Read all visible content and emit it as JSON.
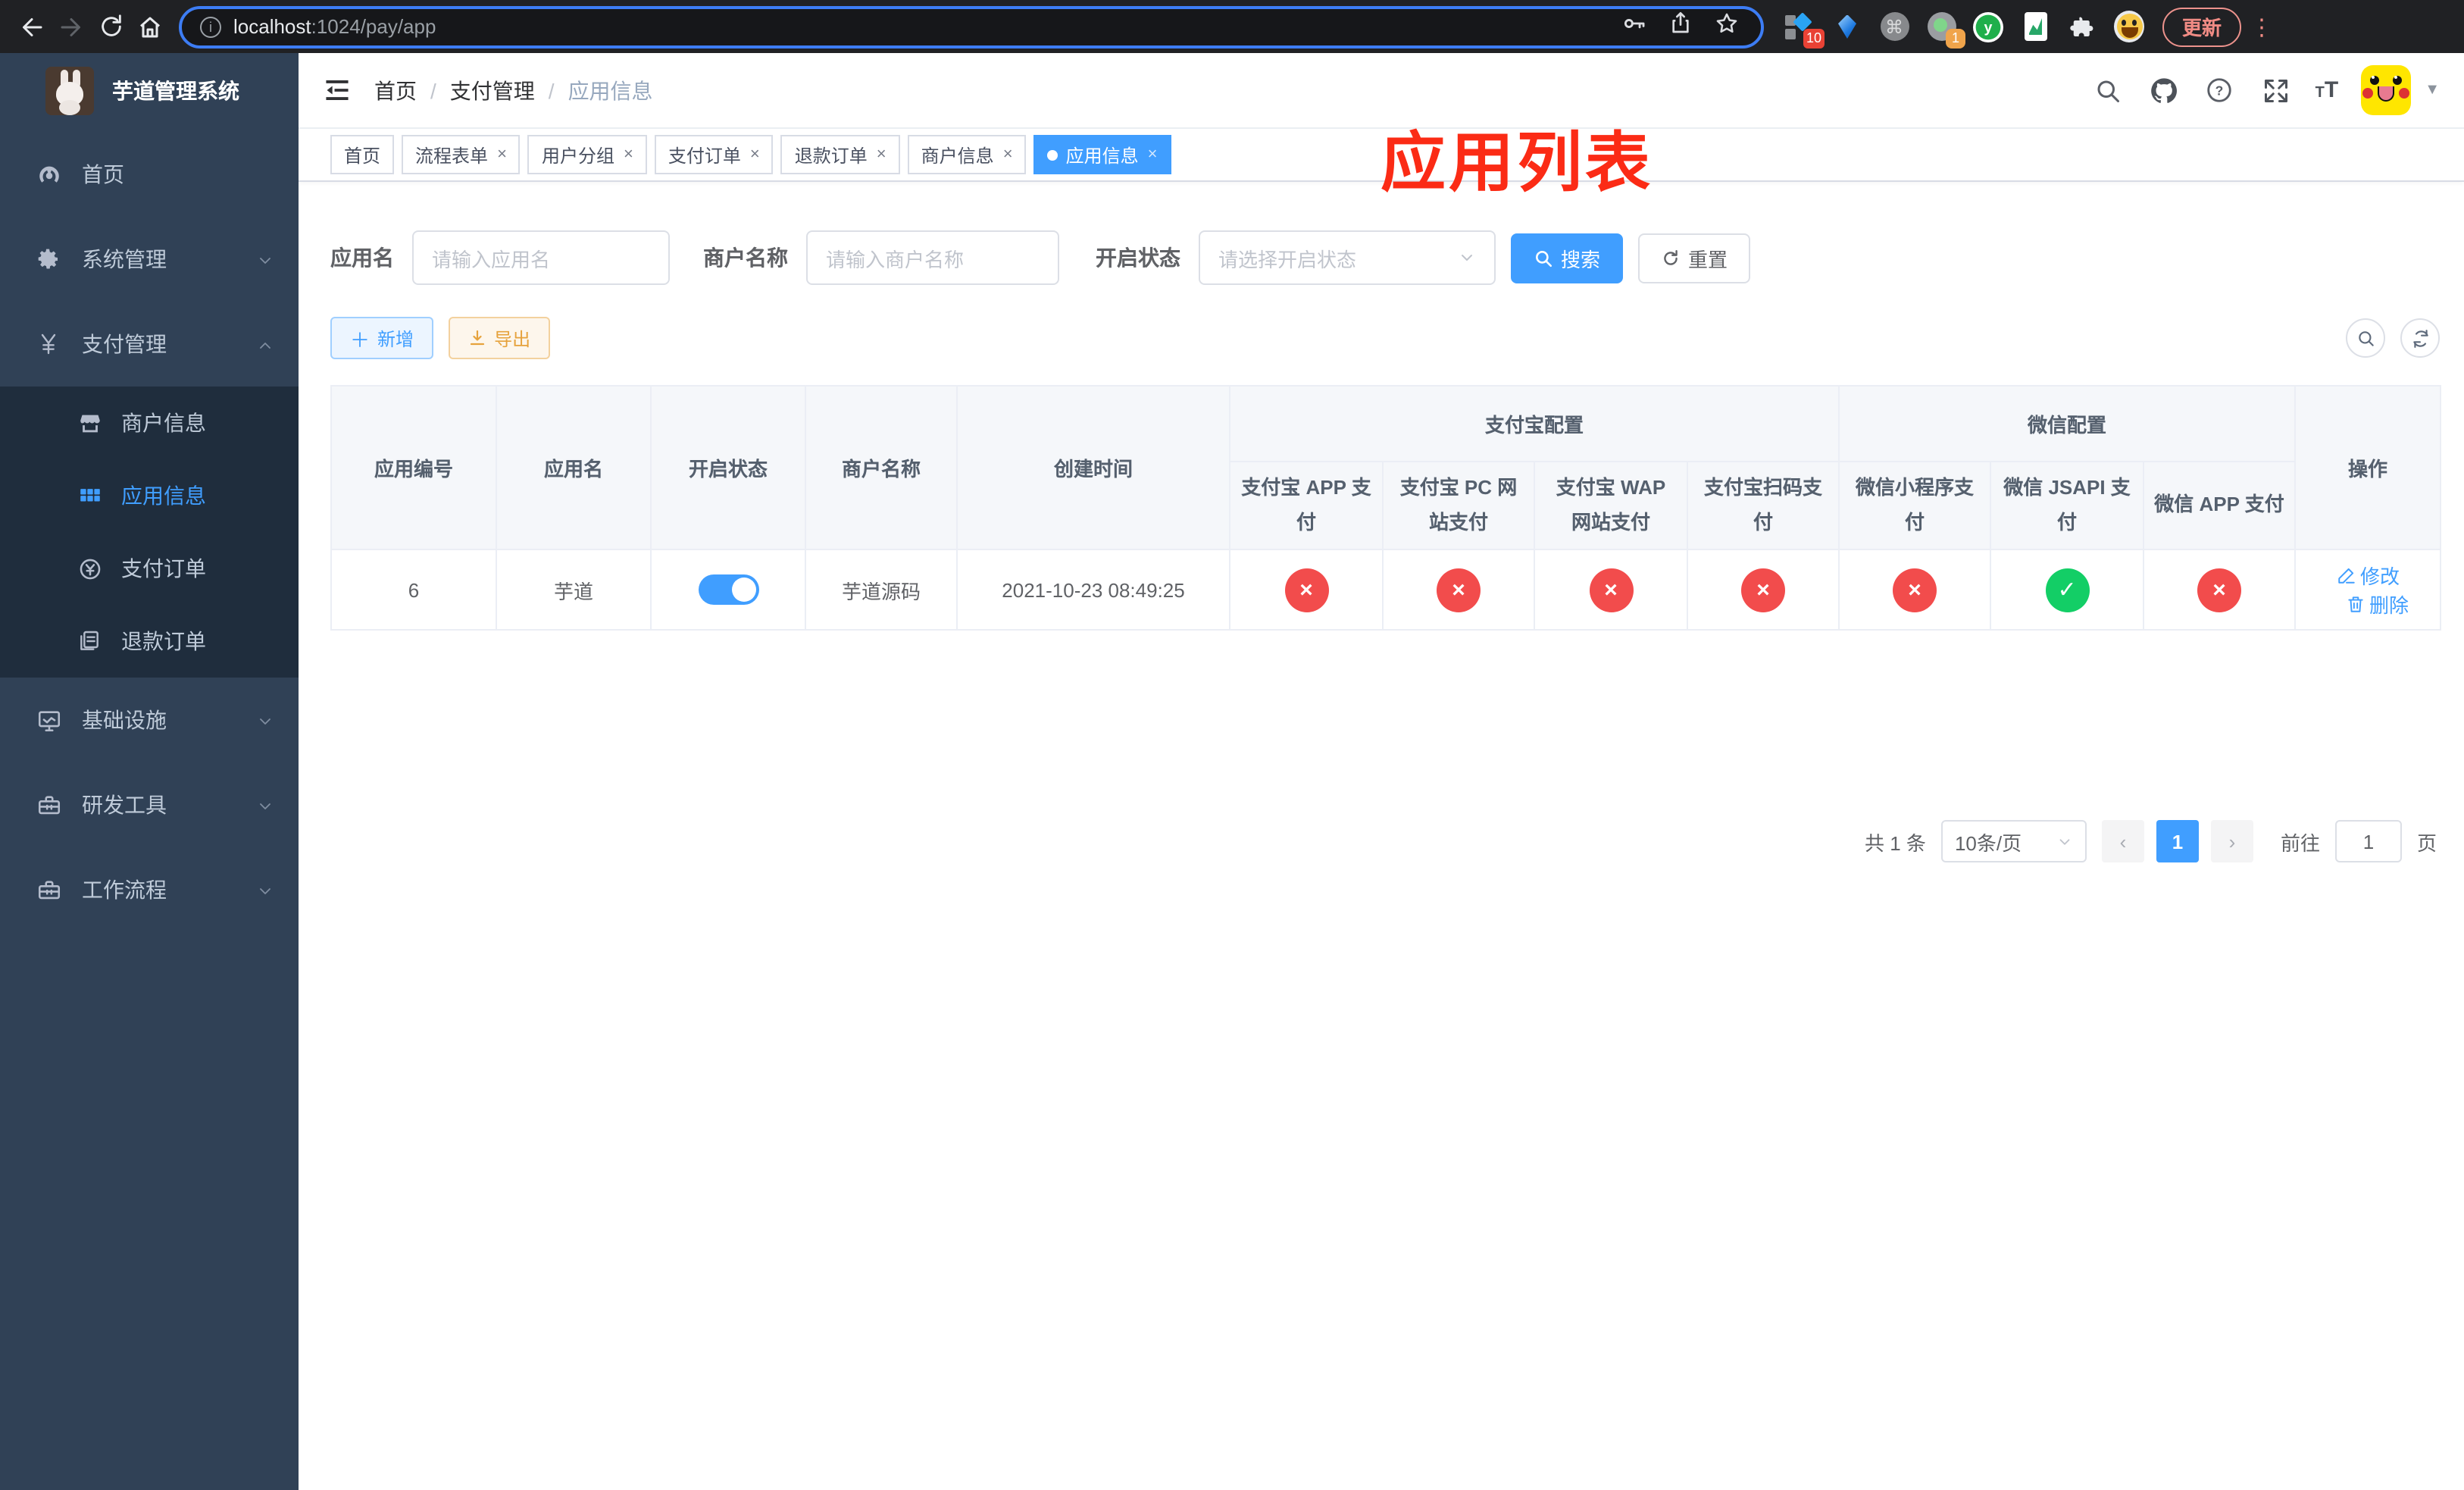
{
  "browser": {
    "url_host": "localhost",
    "url_path": ":1024/pay/app",
    "update_label": "更新",
    "ext_badge_apps": "10",
    "ext_badge_proxy": "1"
  },
  "sidebar": {
    "title": "芋道管理系统",
    "items": [
      {
        "key": "home",
        "label": "首页",
        "icon": "dashboard-icon",
        "type": "item"
      },
      {
        "key": "system",
        "label": "系统管理",
        "icon": "gear-icon",
        "type": "group",
        "state": "collapsed"
      },
      {
        "key": "payment",
        "label": "支付管理",
        "icon": "yen-icon",
        "type": "group",
        "state": "expanded",
        "children": [
          {
            "key": "merchant-info",
            "label": "商户信息",
            "icon": "store-icon",
            "active": false
          },
          {
            "key": "app-info",
            "label": "应用信息",
            "icon": "grid-icon",
            "active": true
          },
          {
            "key": "pay-order",
            "label": "支付订单",
            "icon": "coin-icon",
            "active": false
          },
          {
            "key": "refund-order",
            "label": "退款订单",
            "icon": "document-icon",
            "active": false
          }
        ]
      },
      {
        "key": "infra",
        "label": "基础设施",
        "icon": "monitor-icon",
        "type": "group",
        "state": "collapsed"
      },
      {
        "key": "devtools",
        "label": "研发工具",
        "icon": "toolbox-icon",
        "type": "group",
        "state": "collapsed"
      },
      {
        "key": "workflow",
        "label": "工作流程",
        "icon": "toolbox-icon",
        "type": "group",
        "state": "collapsed"
      }
    ]
  },
  "header": {
    "breadcrumb": [
      "首页",
      "支付管理",
      "应用信息"
    ]
  },
  "annotation": {
    "text": "应用列表"
  },
  "tabs": [
    {
      "key": "home",
      "label": "首页",
      "closable": false,
      "active": false
    },
    {
      "key": "flow-form",
      "label": "流程表单",
      "closable": true,
      "active": false
    },
    {
      "key": "user-group",
      "label": "用户分组",
      "closable": true,
      "active": false
    },
    {
      "key": "pay-order",
      "label": "支付订单",
      "closable": true,
      "active": false
    },
    {
      "key": "refund-order",
      "label": "退款订单",
      "closable": true,
      "active": false
    },
    {
      "key": "merchant-info",
      "label": "商户信息",
      "closable": true,
      "active": false
    },
    {
      "key": "app-info",
      "label": "应用信息",
      "closable": true,
      "active": true
    }
  ],
  "filters": {
    "app_name_label": "应用名",
    "app_name_placeholder": "请输入应用名",
    "merchant_label": "商户名称",
    "merchant_placeholder": "请输入商户名称",
    "status_label": "开启状态",
    "status_placeholder": "请选择开启状态",
    "search_label": "搜索",
    "reset_label": "重置"
  },
  "toolbar": {
    "add_label": "新增",
    "export_label": "导出"
  },
  "table": {
    "simple_columns": [
      "应用编号",
      "应用名",
      "开启状态",
      "商户名称",
      "创建时间"
    ],
    "groups": [
      {
        "label": "支付宝配置",
        "children": [
          "支付宝 APP 支付",
          "支付宝 PC 网站支付",
          "支付宝 WAP 网站支付",
          "支付宝扫码支付"
        ]
      },
      {
        "label": "微信配置",
        "children": [
          "微信小程序支付",
          "微信 JSAPI 支付",
          "微信 APP 支付"
        ]
      }
    ],
    "action_column": "操作",
    "row": {
      "id": "6",
      "name": "芋道",
      "enabled": true,
      "merchant": "芋道源码",
      "created_at": "2021-10-23 08:49:25",
      "configs": [
        false,
        false,
        false,
        false,
        false,
        true,
        false
      ],
      "edit_label": "修改",
      "delete_label": "删除"
    }
  },
  "pagination": {
    "total": "共 1 条",
    "page_size": "10条/页",
    "prev": "‹",
    "current_page": "1",
    "next": "›",
    "goto_label": "前往",
    "goto_value": "1",
    "page_unit": "页"
  }
}
